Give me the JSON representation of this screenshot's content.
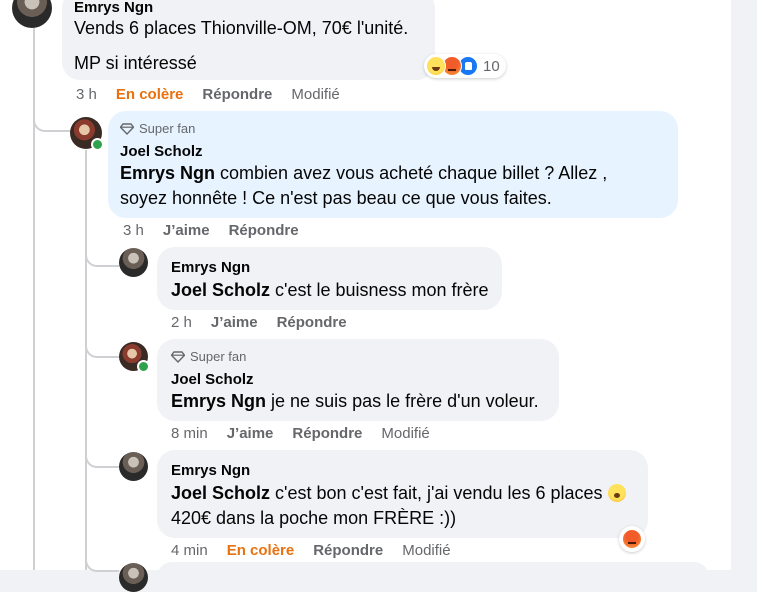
{
  "colors": {
    "angry_accent": "#e9710f",
    "highlight_bubble": "#e7f3ff",
    "bubble": "#f0f2f5",
    "meta_text": "#65676b"
  },
  "comments": [
    {
      "author": "Emrys Ngn",
      "lines": [
        "Vends 6 places Thionville-OM, 70€ l'unité.",
        "MP si intéressé"
      ],
      "reactions": {
        "icons": [
          "haha-icon",
          "angry-icon",
          "like-icon"
        ],
        "count": "10"
      },
      "time": "3 h",
      "reaction_label": "En colère",
      "reply": "Répondre",
      "edited": "Modifié"
    },
    {
      "badge": "Super fan",
      "author": "Joel Scholz",
      "mention": "Emrys Ngn",
      "line1": " combien avez vous acheté chaque billet ? Allez ,",
      "line2": "soyez honnête ! Ce n'est pas beau ce que vous faites.",
      "time": "3 h",
      "like": "J’aime",
      "reply": "Répondre"
    },
    {
      "author": "Emrys Ngn",
      "mention": "Joel Scholz",
      "text": " c'est le buisness mon frère",
      "time": "2 h",
      "like": "J’aime",
      "reply": "Répondre"
    },
    {
      "badge": "Super fan",
      "author": "Joel Scholz",
      "mention": "Emrys Ngn",
      "text": " je ne suis pas le frère d'un voleur.",
      "time": "8 min",
      "like": "J’aime",
      "reply": "Répondre",
      "edited": "Modifié"
    },
    {
      "author": "Emrys Ngn",
      "mention": "Joel Scholz",
      "line1": " c'est bon c'est fait, j'ai vendu les 6 places",
      "line2": "420€ dans la poche mon FRÈRE :))",
      "inline_emoji": "shocked-emoji-icon",
      "reaction_icon": "angry-icon",
      "time": "4 min",
      "reaction_label": "En colère",
      "reply": "Répondre",
      "edited": "Modifié"
    }
  ]
}
